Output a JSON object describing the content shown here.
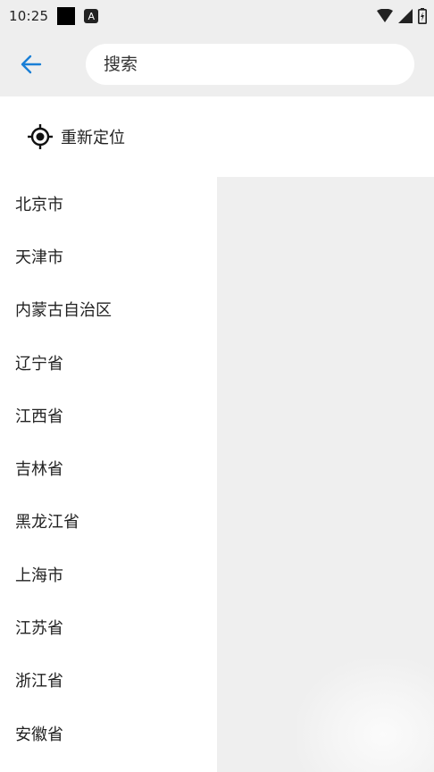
{
  "status_bar": {
    "time": "10:25",
    "notification_badge": "A"
  },
  "header": {
    "back_icon": "arrow-left-icon",
    "search_placeholder": "搜索",
    "accent_color": "#1a7fd6"
  },
  "relocate": {
    "icon": "locate-icon",
    "label": "重新定位"
  },
  "provinces": [
    "北京市",
    "天津市",
    "内蒙古自治区",
    "辽宁省",
    "江西省",
    "吉林省",
    "黑龙江省",
    "上海市",
    "江苏省",
    "浙江省",
    "安徽省"
  ]
}
